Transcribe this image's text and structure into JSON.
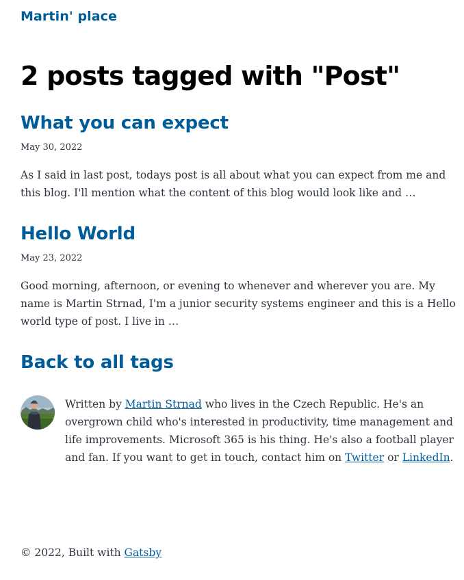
{
  "header": {
    "site_title": "Martin' place"
  },
  "main": {
    "page_title": "2 posts tagged with \"Post\"",
    "posts": [
      {
        "title": "What you can expect",
        "date": "May 30, 2022",
        "excerpt": "As I said in last post, todays post is all about what you can expect from me and this blog. I'll mention what the content of this blog would look like and …"
      },
      {
        "title": "Hello World",
        "date": "May 23, 2022",
        "excerpt": "Good morning, afternoon, or evening to whenever and wherever you are. My name is Martin Strnad, I'm a junior security systems engineer and this is a Hello world type of post. I live in …"
      }
    ],
    "back_link": "Back to all tags"
  },
  "bio": {
    "prefix": "Written by ",
    "author_name": "Martin Strnad",
    "middle": " who lives in the Czech Republic. He's an overgrown child who's interested in productivity, time management and life improvements. Microsoft 365 is his thing. He's also a football player and fan. If you want to get in touch, contact him on ",
    "twitter_label": "Twitter",
    "or": " or ",
    "linkedin_label": "LinkedIn",
    "suffix": "."
  },
  "footer": {
    "prefix": "© 2022, Built with ",
    "gatsby_label": "Gatsby"
  },
  "colors": {
    "accent": "#005b99",
    "text": "#2e353f",
    "heading": "#000000"
  }
}
